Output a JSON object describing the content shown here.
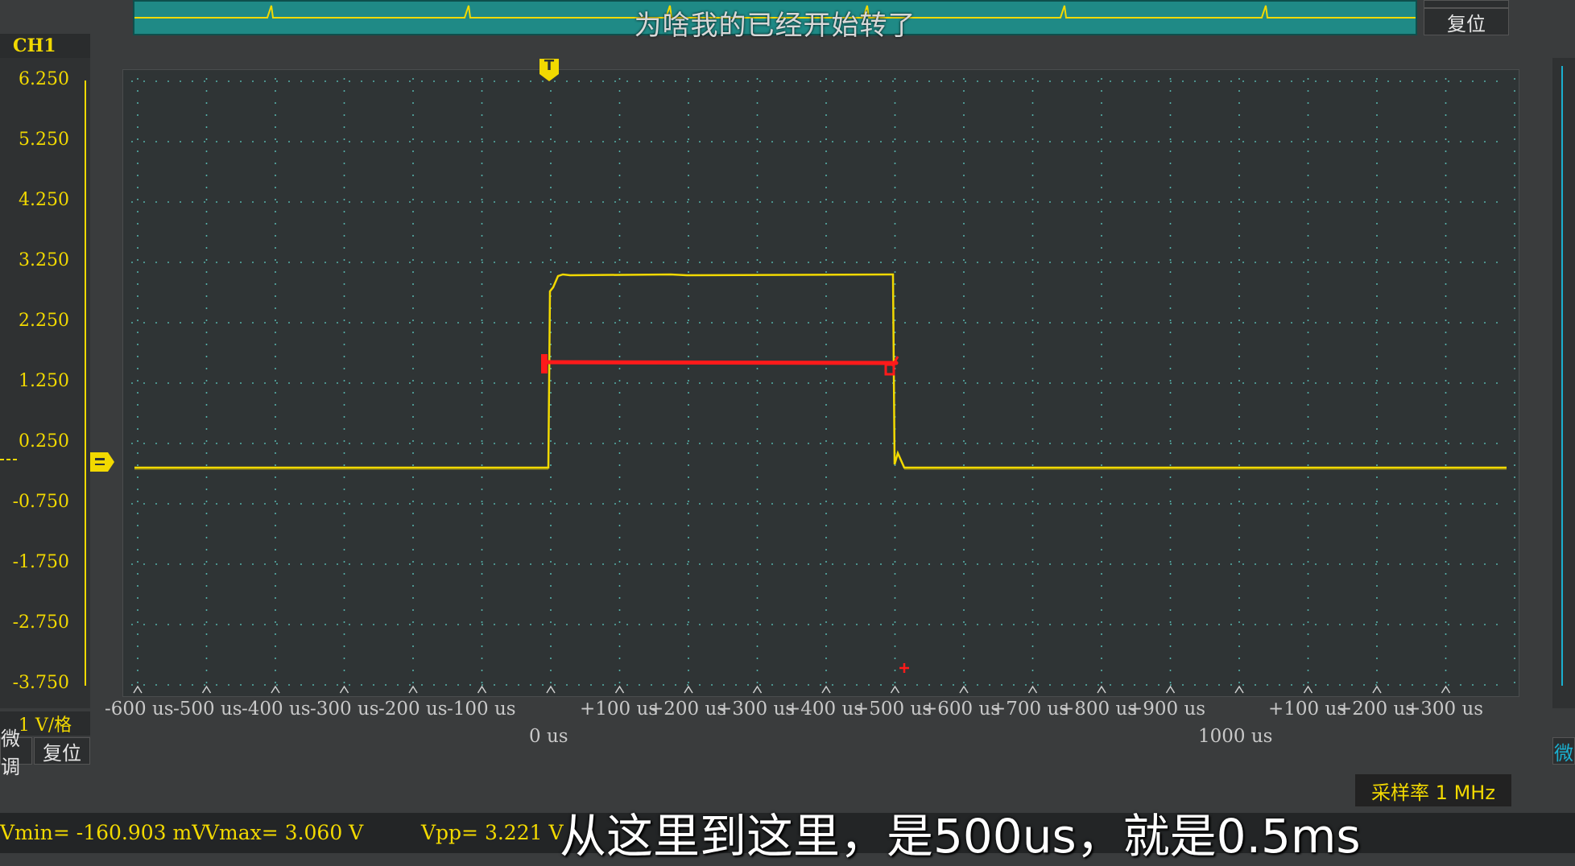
{
  "overview": {
    "subtitle": "为啥我的已经开始转了",
    "reset_label": "复位",
    "top_btn_label": "微调"
  },
  "channel": {
    "name": "CH1",
    "scale": "1 V/格",
    "fine_label": "微调",
    "reset_label": "复位"
  },
  "right_panel": {
    "fine_label": "微"
  },
  "trigger": {
    "marker": "T"
  },
  "y_axis": {
    "ticks": [
      "6.250",
      "5.250",
      "4.250",
      "3.250",
      "2.250",
      "1.250",
      "0.250",
      "-0.750",
      "-1.750",
      "-2.750",
      "-3.750"
    ]
  },
  "x_axis": {
    "ticks": [
      "-600 us",
      "-500 us",
      "-400 us",
      "-300 us",
      "-200 us",
      "-100 us",
      "+100 us",
      "+200 us",
      "+300 us",
      "+400 us",
      "+500 us",
      "+600 us",
      "+700 us",
      "+800 us",
      "+900 us",
      "+100 us",
      "+200 us",
      "+300 us"
    ],
    "major": [
      "0 us",
      "1000 us"
    ]
  },
  "sample_rate": "采样率 1 MHz",
  "measurements": {
    "vmin": "Vmin= -160.903 mV",
    "vmax": "Vmax= 3.060 V",
    "vpp": "Vpp= 3.221 V"
  },
  "caption": "从这里到这里，是500us，就是0.5ms",
  "colors": {
    "trace": "#f2d900",
    "cursor": "#ff1a1a",
    "grid": "#55b0a8"
  }
}
